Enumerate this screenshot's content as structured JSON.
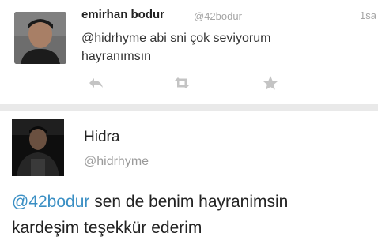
{
  "tweet1": {
    "author_name": "emirhan bodur",
    "author_handle": "@42bodur",
    "time": "1sa",
    "text_line1": "@hidrhyme  abi sni çok seviyorum",
    "text_line2": "hayranımsın",
    "actions": [
      "reply-icon",
      "retweet-icon",
      "favorite-icon"
    ]
  },
  "tweet2": {
    "author_name": "Hidra",
    "author_handle": "@hidrhyme",
    "mention": "@42bodur",
    "text_rest": " sen de benim hayranimsin",
    "text_line2": "kardeşim teşekkür ederim"
  },
  "colors": {
    "mention": "#3a8fc4",
    "handle": "#a5a5a5",
    "action_icon": "#c4c4c4"
  }
}
